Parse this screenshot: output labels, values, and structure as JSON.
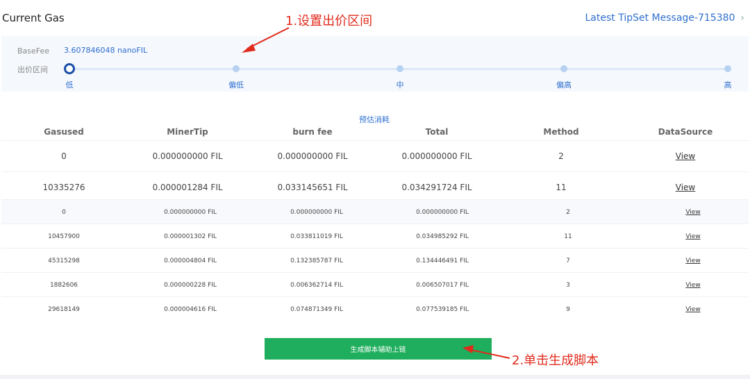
{
  "header": {
    "title": "Current Gas",
    "latest_link": "Latest TipSet Message-715380",
    "chevron_icon": "chevron-right-icon"
  },
  "base_fee": {
    "label": "BaseFee",
    "value": "3.607846048 nanoFIL"
  },
  "price_range": {
    "label": "出价区间",
    "stops": [
      "低",
      "偏低",
      "中",
      "偏高",
      "高"
    ],
    "selected_index": 0
  },
  "annotations": {
    "step1": "1.设置出价区间",
    "step2": "2.单击生成脚本"
  },
  "table": {
    "group_header": "预估消耗",
    "columns": [
      "Gasused",
      "MinerTip",
      "burn fee",
      "Total",
      "Method",
      "DataSource"
    ],
    "rows_large": [
      [
        "0",
        "0.000000000 FIL",
        "0.000000000 FIL",
        "0.000000000 FIL",
        "2",
        "View"
      ],
      [
        "10335276",
        "0.000001284 FIL",
        "0.033145651 FIL",
        "0.034291724 FIL",
        "11",
        "View"
      ]
    ],
    "rows_small": [
      [
        "0",
        "0.000000000 FIL",
        "0.000000000 FIL",
        "0.000000000 FIL",
        "2",
        "View"
      ],
      [
        "10457900",
        "0.000001302 FIL",
        "0.033811019 FIL",
        "0.034985292 FIL",
        "11",
        "View"
      ],
      [
        "45315298",
        "0.000004804 FIL",
        "0.132385787 FIL",
        "0.134446491 FIL",
        "7",
        "View"
      ],
      [
        "1882606",
        "0.000000228 FIL",
        "0.006362714 FIL",
        "0.006507017 FIL",
        "3",
        "View"
      ],
      [
        "29618149",
        "0.000004616 FIL",
        "0.074871349 FIL",
        "0.077539185 FIL",
        "9",
        "View"
      ]
    ]
  },
  "generate_button": {
    "label": "生成脚本辅助上链"
  },
  "colors": {
    "accent": "#2f6fd0",
    "button": "#1fae5d",
    "annotation": "#e02a1c"
  }
}
